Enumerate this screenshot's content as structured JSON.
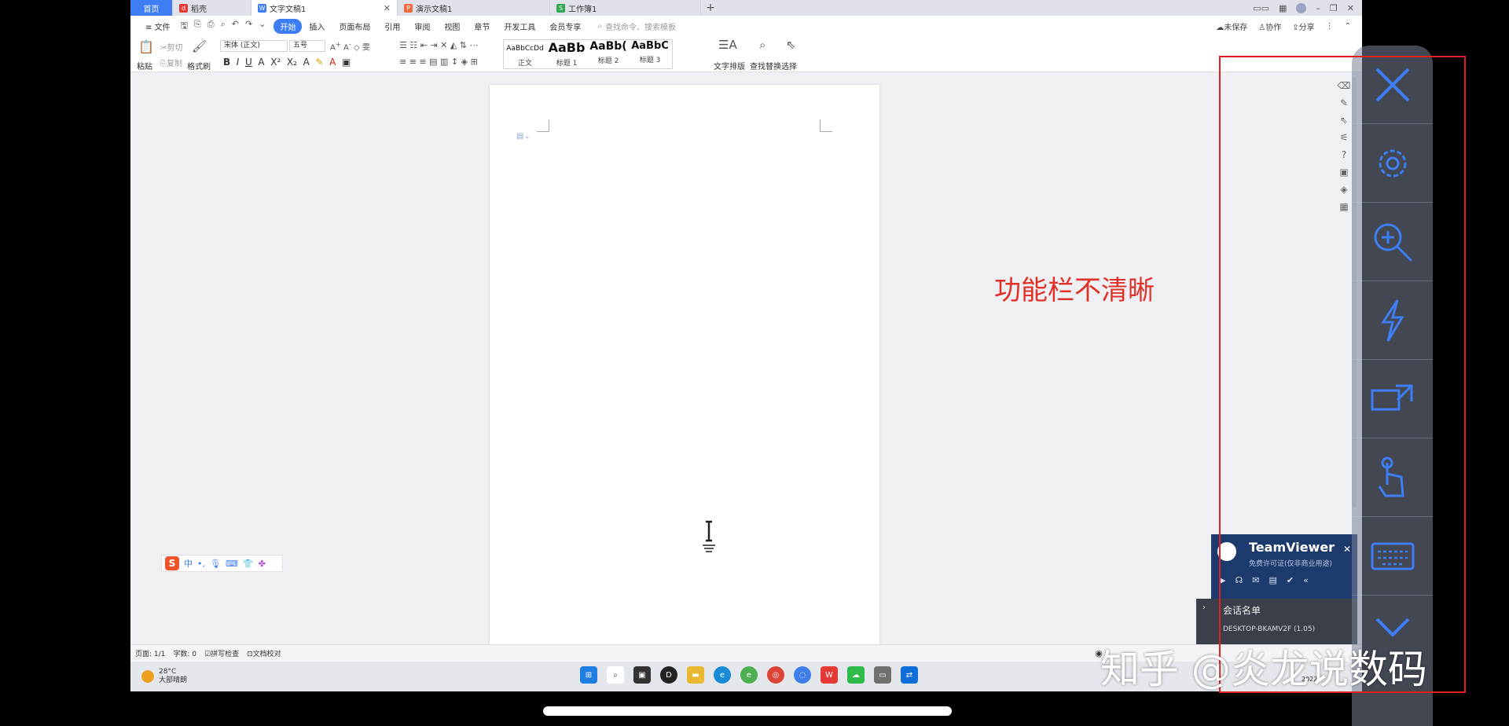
{
  "tabs": [
    {
      "label": "首页"
    },
    {
      "label": "稻壳"
    },
    {
      "label": "文字文稿1"
    },
    {
      "label": "演示文稿1"
    },
    {
      "label": "工作簿1"
    }
  ],
  "menu": {
    "file": "文件",
    "items": [
      "开始",
      "插入",
      "页面布局",
      "引用",
      "审阅",
      "视图",
      "章节",
      "开发工具",
      "会员专享"
    ],
    "search": "查找命令、搜索模板",
    "unsaved": "未保存",
    "collab": "协作",
    "share": "分享"
  },
  "ribbon": {
    "paste": "粘贴",
    "cut": "剪切",
    "copy": "复制",
    "format_painter": "格式刷",
    "font_name": "宋体 (正文)",
    "font_size": "五号",
    "styles": [
      {
        "preview": "AaBbCcDd",
        "label": "正文"
      },
      {
        "preview": "AaBb",
        "label": "标题 1"
      },
      {
        "preview": "AaBb(",
        "label": "标题 2"
      },
      {
        "preview": "AaBbC",
        "label": "标题 3"
      }
    ],
    "text_layout": "文字排版",
    "find_replace": "查找替换",
    "select": "选择"
  },
  "status": {
    "page": "页面: 1/1",
    "words": "字数: 0",
    "spell": "拼写检查",
    "proof": "文档校对"
  },
  "weather": {
    "temp": "28°C",
    "desc": "大部晴朗"
  },
  "taskbar_date": "2022/",
  "annotation": "功能栏不清晰",
  "teamviewer": {
    "name": "TeamViewer",
    "subtitle": "免费许可证(仅非商业用途)",
    "session_list": "会话名单",
    "device": "DESKTOP-BKAMV2F (1.05)"
  },
  "watermark": "知乎 @炎龙说数码",
  "colors": {
    "accent": "#3d7ef5",
    "annotation_red": "#e03027",
    "teamviewer_blue": "#1c3a6c"
  }
}
